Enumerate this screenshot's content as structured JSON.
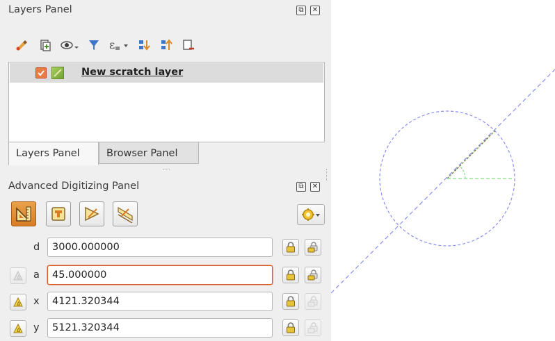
{
  "layers_panel": {
    "title": "Layers Panel",
    "float_icon": "float-panel-icon",
    "close_icon": "close-panel-icon",
    "toolbar": [
      {
        "name": "style-manager-icon",
        "color": "#d98b2b"
      },
      {
        "name": "add-group-icon",
        "color": "#6b6b6b"
      },
      {
        "name": "visibility-eye-icon",
        "color": "#5a5a5a"
      },
      {
        "name": "filter-legend-icon",
        "color": "#3f74c6"
      },
      {
        "name": "filter-expression-icon",
        "color": "#555555"
      },
      {
        "name": "expand-all-icon",
        "color": "#3f74c6"
      },
      {
        "name": "collapse-all-icon",
        "color": "#3f74c6"
      },
      {
        "name": "remove-layer-icon",
        "color": "#c0392b"
      }
    ],
    "layers": [
      {
        "name": "New scratch layer",
        "checked": true
      }
    ]
  },
  "tabs": {
    "layers": "Layers Panel",
    "browser": "Browser Panel",
    "active": "Layers Panel"
  },
  "adv_digitizing": {
    "title": "Advanced Digitizing Panel",
    "modes": [
      {
        "name": "enable-advanced-digitizing-icon",
        "active": true
      },
      {
        "name": "construction-mode-icon",
        "active": false
      },
      {
        "name": "parallel-icon",
        "active": false
      },
      {
        "name": "perpendicular-icon",
        "active": false
      }
    ],
    "settings_icon": "gear-dropdown-icon",
    "fields": [
      {
        "label": "d",
        "value": "3000.000000",
        "focused": false
      },
      {
        "label": "a",
        "value": "45.000000",
        "focused": true
      },
      {
        "label": "x",
        "value": "4121.320344",
        "focused": false
      },
      {
        "label": "y",
        "value": "5121.320344",
        "focused": false
      }
    ]
  },
  "colors": {
    "accent": "#e05a28",
    "guide_line": "#8a8ef0",
    "angle_guide": "#7fe07f",
    "lock_yellow": "#e8c33c"
  }
}
